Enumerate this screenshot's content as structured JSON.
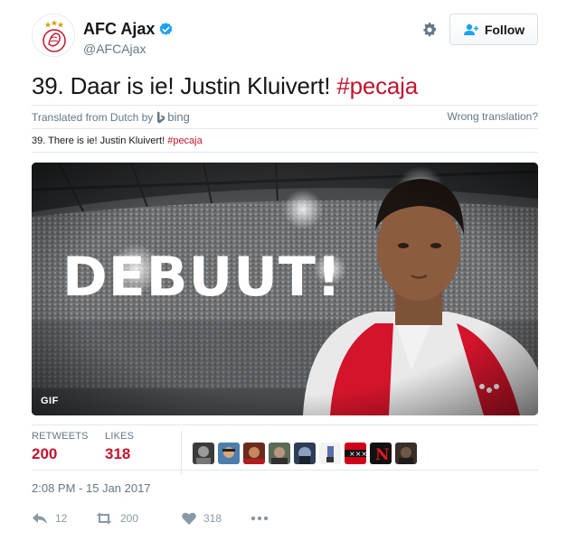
{
  "account": {
    "display_name": "AFC Ajax",
    "handle": "@AFCAjax",
    "follow_label": "Follow"
  },
  "tweet": {
    "text_main": "39. Daar is ie! Justin Kluivert! ",
    "hashtag": "#pecaja",
    "translated_prefix": "Translated from Dutch by",
    "translator": "bing",
    "wrong_translation": "Wrong translation?",
    "translated_text": "39. There is ie! Justin Kluivert! ",
    "translated_hashtag": "#pecaja"
  },
  "media": {
    "overlay_text": "DEBUUT!",
    "badge": "GIF"
  },
  "stats": {
    "retweets_label": "RETWEETS",
    "retweets_value": "200",
    "likes_label": "LIKES",
    "likes_value": "318"
  },
  "timestamp": "2:08 PM - 15 Jan 2017",
  "actions": {
    "reply_count": "12",
    "retweet_count": "200",
    "like_count": "318"
  },
  "colors": {
    "accent": "#c0152e",
    "verified": "#1da1f2",
    "muted": "#657786"
  }
}
